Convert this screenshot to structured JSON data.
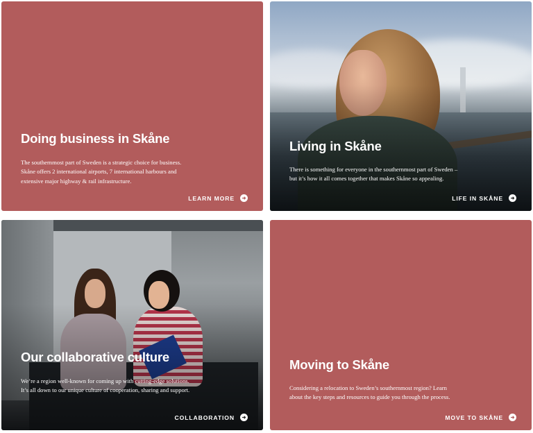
{
  "cards": [
    {
      "title": "Doing business in Skåne",
      "description": "The southernmost part of Sweden is a strategic choice for business. Skåne offers 2 international airports, 7 international harbours and extensive major highway & rail infrastructure.",
      "cta": "LEARN MORE",
      "cta_icon": "arrow-right-circle-icon",
      "background": "#b25c5c"
    },
    {
      "title": "Living in Skåne",
      "description": "There is something for everyone in the southernmost part of Sweden – but it’s how it all comes together that makes Skåne so appealing.",
      "cta": "LIFE IN SKÅNE",
      "cta_icon": "arrow-right-circle-icon"
    },
    {
      "title": "Our collaborative culture",
      "description": "We’re a region well-known for coming up with cutting-edge solutions. It’s all down to our unique culture of cooperation, sharing and support.",
      "cta": "COLLABORATION",
      "cta_icon": "arrow-right-circle-icon"
    },
    {
      "title": "Moving to Skåne",
      "description": "Considering a relocation to Sweden’s southernmost region? Learn about the key steps and resources to guide you through the process.",
      "cta": "MOVE TO SKÅNE",
      "cta_icon": "arrow-right-circle-icon",
      "background": "#b25c5c"
    }
  ],
  "colors": {
    "accent": "#b25c5c",
    "text": "#ffffff"
  }
}
